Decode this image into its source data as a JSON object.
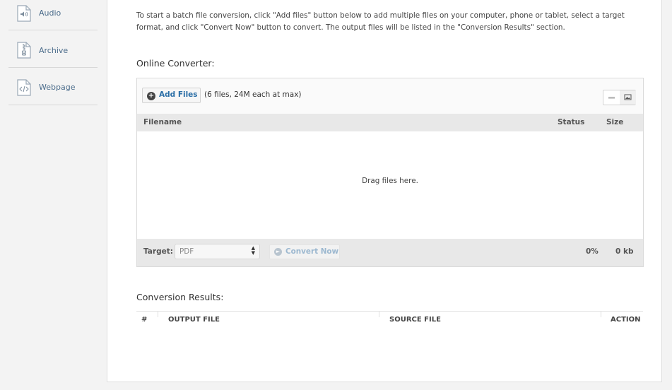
{
  "sidebar": {
    "items": [
      {
        "label": "Audio",
        "icon": "audio-file-icon"
      },
      {
        "label": "Archive",
        "icon": "archive-file-icon"
      },
      {
        "label": "Webpage",
        "icon": "webpage-file-icon"
      }
    ]
  },
  "intro": {
    "text": "To start a batch file conversion, click \"Add files\" button below to add multiple files on your computer, phone or tablet, select a target format, and click \"Convert Now\" button to convert. The output files will be listed in the \"Conversion Results\" section."
  },
  "converter": {
    "title": "Online Converter:",
    "add_files_label": "Add Files",
    "limit_text": "(6 files, 24M each at max)",
    "columns": {
      "filename": "Filename",
      "status": "Status",
      "size": "Size"
    },
    "drop_text": "Drag files here.",
    "target_label": "Target:",
    "target_value": "PDF",
    "convert_label": "Convert Now",
    "progress": "0%",
    "total_size": "0 kb"
  },
  "results": {
    "title": "Conversion Results:",
    "columns": {
      "index": "#",
      "output": "OUTPUT FILE",
      "source": "SOURCE FILE",
      "action": "ACTION"
    }
  },
  "colors": {
    "link_blue": "#2a6ea6",
    "sidebar_label": "#4a6b8a",
    "header_gray": "#e8e8e8"
  }
}
